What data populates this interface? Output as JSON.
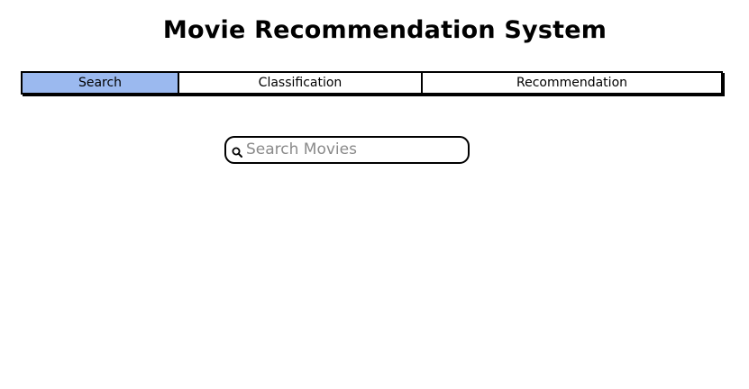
{
  "page": {
    "title": "Movie Recommendation System"
  },
  "tabs": [
    {
      "label": "Search",
      "active": true
    },
    {
      "label": "Classification",
      "active": false
    },
    {
      "label": "Recommendation",
      "active": false
    }
  ],
  "search": {
    "placeholder": "Search Movies",
    "value": "",
    "icon": "search-icon"
  },
  "colors": {
    "active_tab": "#9bb9ef",
    "border": "#000000",
    "placeholder_text": "#8a8a8a"
  }
}
